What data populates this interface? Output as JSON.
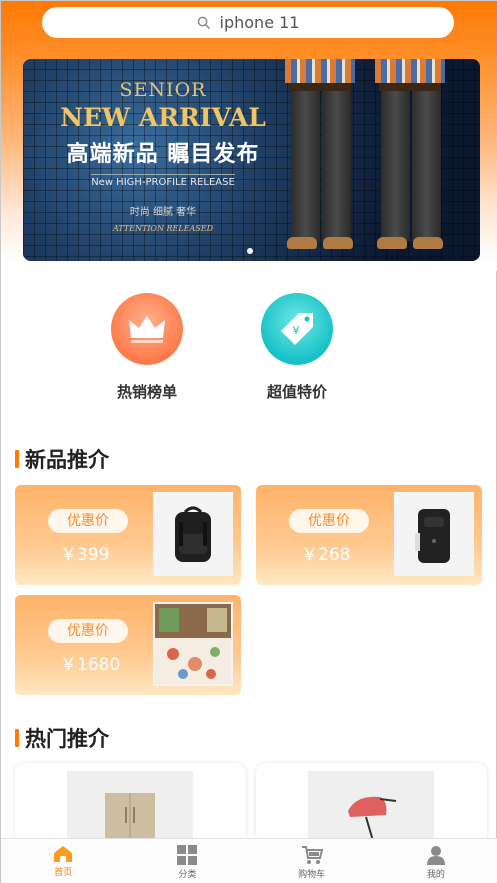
{
  "search": {
    "text": "iphone 11",
    "icon": "search-icon"
  },
  "banner": {
    "line1": "SENIOR",
    "line2": "NEW ARRIVAL",
    "line3": "高端新品 瞩目发布",
    "line4": "New HIGH-PROFILE RELEASE",
    "line5": "时尚 细腻 奢华",
    "line6": "ATTENTION RELEASED"
  },
  "categories": [
    {
      "label": "热销榜单",
      "icon": "crown-icon",
      "color": "#ff7a4a"
    },
    {
      "label": "超值特价",
      "icon": "price-tag-icon",
      "color": "#1cc7c7"
    }
  ],
  "new_section": {
    "title": "新品推介"
  },
  "new_products": [
    {
      "badge": "优惠价",
      "price": "￥399"
    },
    {
      "badge": "优惠价",
      "price": "￥268"
    },
    {
      "badge": "优惠价",
      "price": "￥1680"
    }
  ],
  "hot_section": {
    "title": "热门推介"
  },
  "tabbar": {
    "items": [
      {
        "label": "首页",
        "icon": "home-icon",
        "active": true
      },
      {
        "label": "分类",
        "icon": "grid-icon",
        "active": false
      },
      {
        "label": "购物车",
        "icon": "cart-icon",
        "active": false
      },
      {
        "label": "我的",
        "icon": "user-icon",
        "active": false
      }
    ]
  },
  "colors": {
    "accent": "#ff7a06",
    "price_pill_text": "#ff8a2a"
  }
}
